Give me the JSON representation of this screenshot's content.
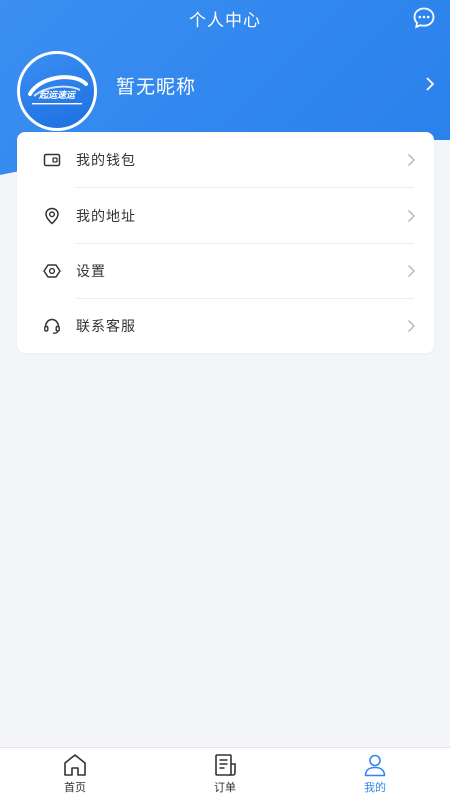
{
  "header": {
    "title": "个人中心",
    "background_color": "#2f86ee"
  },
  "profile": {
    "nickname": "暂无昵称",
    "logo_text": "起运速运"
  },
  "menu": [
    {
      "label": "我的钱包",
      "icon": "wallet-icon"
    },
    {
      "label": "我的地址",
      "icon": "location-icon"
    },
    {
      "label": "设置",
      "icon": "settings-icon"
    },
    {
      "label": "联系客服",
      "icon": "headset-icon"
    }
  ],
  "tabbar": {
    "tabs": [
      {
        "label": "首页",
        "icon": "home-icon",
        "active": false
      },
      {
        "label": "订单",
        "icon": "order-icon",
        "active": false
      },
      {
        "label": "我的",
        "icon": "user-icon",
        "active": true
      }
    ],
    "active_color": "#2f86ee"
  }
}
